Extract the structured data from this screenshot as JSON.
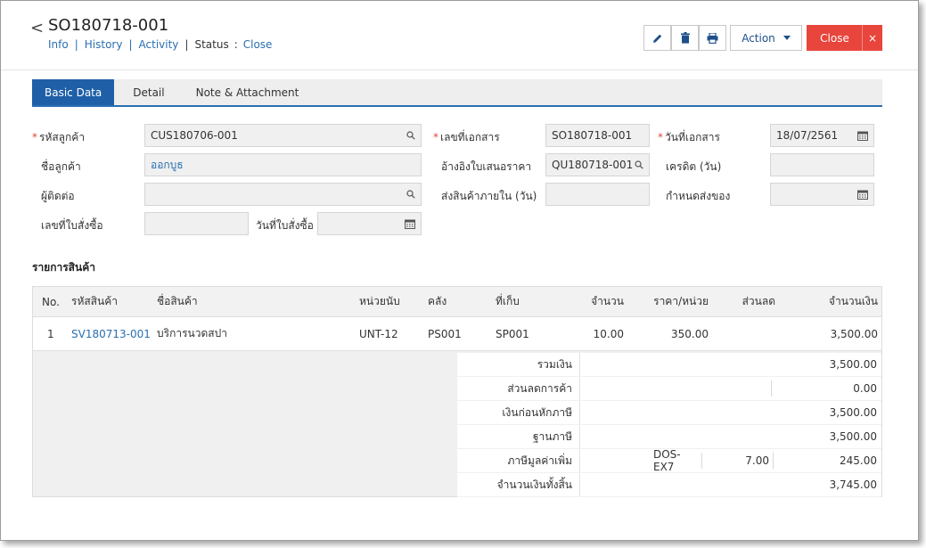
{
  "header": {
    "back_symbol": "<",
    "title": "SO180718-001",
    "links": {
      "info": "Info",
      "history": "History",
      "activity": "Activity",
      "status_label": "Status",
      "status_colon": ":",
      "status_value": "Close",
      "separator": "|"
    },
    "icons": {
      "edit": "pencil-icon",
      "delete": "trash-icon",
      "print": "printer-icon"
    },
    "action_label": "Action",
    "close_label": "Close",
    "close_x": "×"
  },
  "tabs": [
    {
      "label": "Basic Data",
      "active": true
    },
    {
      "label": "Detail"
    },
    {
      "label": "Note & Attachment"
    }
  ],
  "form": {
    "customer_code_label": "รหัสลูกค้า",
    "customer_code_value": "CUS180706-001",
    "customer_name_label": "ชื่อลูกค้า",
    "customer_name_value": "ออกบูธ",
    "contact_label": "ผู้ติดต่อ",
    "contact_value": "",
    "po_no_label": "เลขที่ใบสั่งซื้อ",
    "po_no_value": "",
    "po_date_label": "วันที่ใบสั่งซื้อ",
    "po_date_value": "",
    "doc_no_label": "เลขที่เอกสาร",
    "doc_no_value": "SO180718-001",
    "quote_ref_label": "อ้างอิงใบเสนอราคา",
    "quote_ref_value": "QU180718-001",
    "delivery_days_label": "ส่งสินค้าภายใน (วัน)",
    "delivery_days_value": "",
    "doc_date_label": "วันที่เอกสาร",
    "doc_date_value": "18/07/2561",
    "credit_label": "เครดิต (วัน)",
    "credit_value": "",
    "delivery_due_label": "กำหนดส่งของ",
    "delivery_due_value": "",
    "required_mark": "*",
    "search_icon": "magnifier-icon",
    "calendar_icon": "calendar-icon"
  },
  "items_section_title": "รายการสินค้า",
  "table": {
    "columns": [
      "No.",
      "รหัสสินค้า",
      "ชื่อสินค้า",
      "หน่วยนับ",
      "คลัง",
      "ที่เก็บ",
      "จำนวน",
      "ราคา/หน่วย",
      "ส่วนลด",
      "จำนวนเงิน"
    ],
    "rows": [
      {
        "no": "1",
        "code": "SV180713-001",
        "name": "บริการนวดสปา",
        "unit": "UNT-12",
        "warehouse": "PS001",
        "location": "SP001",
        "qty": "10.00",
        "price": "350.00",
        "discount": "",
        "amount": "3,500.00"
      }
    ]
  },
  "summary": {
    "subtotal_label": "รวมเงิน",
    "subtotal_value": "3,500.00",
    "trade_discount_label": "ส่วนลดการค้า",
    "trade_discount_value": "0.00",
    "before_tax_label": "เงินก่อนหักภาษี",
    "before_tax_value": "3,500.00",
    "tax_base_label": "ฐานภาษี",
    "tax_base_value": "3,500.00",
    "vat_label": "ภาษีมูลค่าเพิ่ม",
    "vat_code": "DOS-EX7",
    "vat_rate": "7.00",
    "vat_value": "245.00",
    "grand_total_label": "จำนวนเงินทั้งสิ้น",
    "grand_total_value": "3,745.00"
  }
}
